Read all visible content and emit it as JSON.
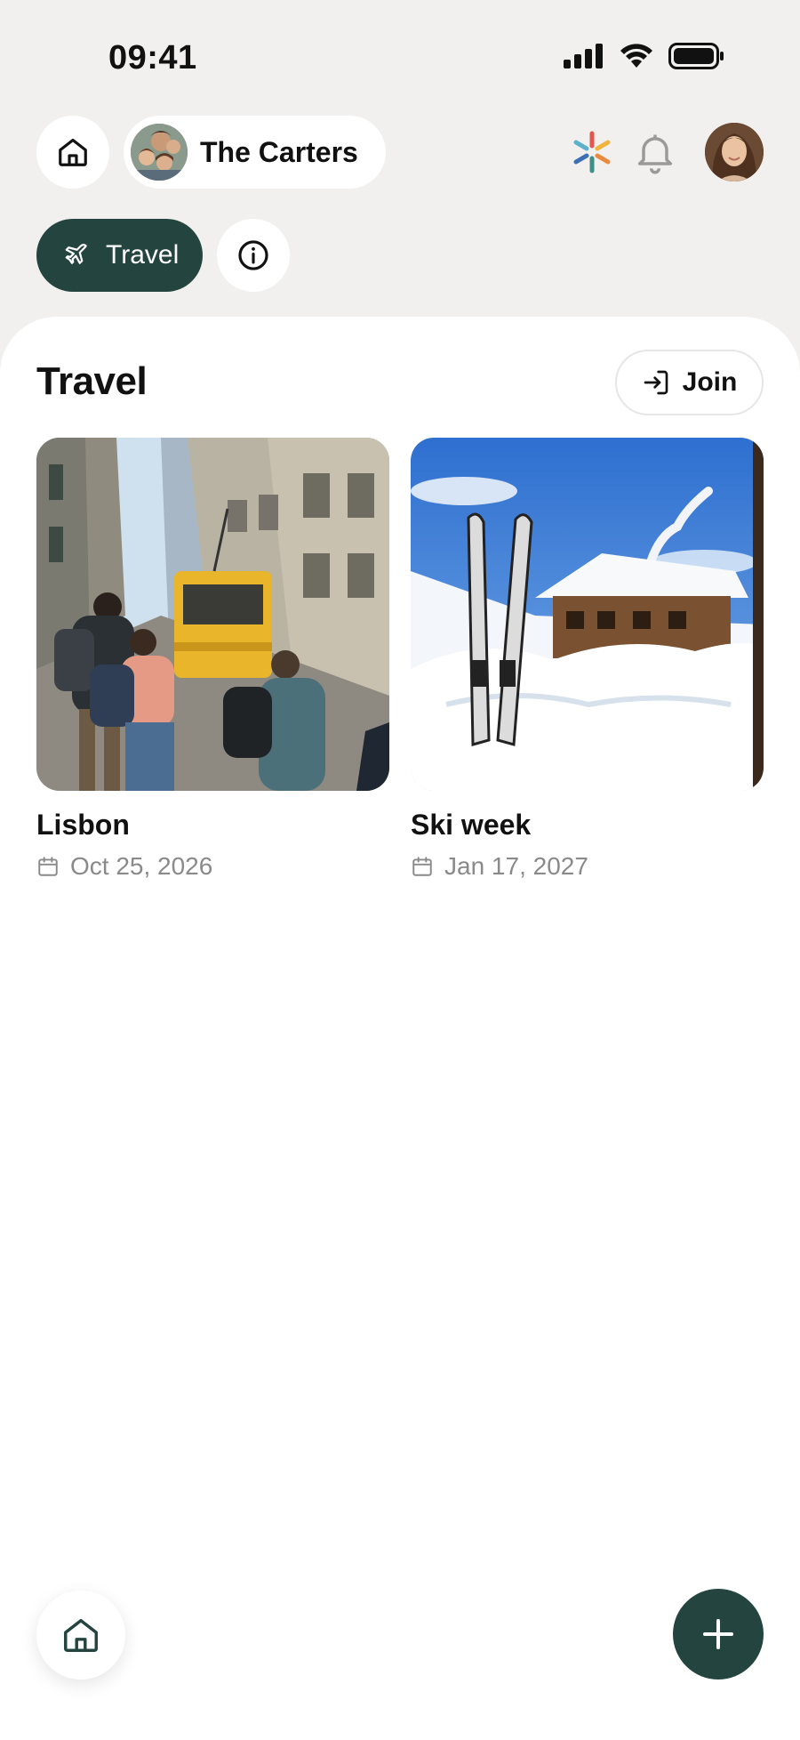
{
  "status_bar": {
    "time": "09:41"
  },
  "header": {
    "family_name": "The Carters",
    "icons": [
      "home-icon",
      "sparkle-icon",
      "bell-icon",
      "user-avatar"
    ]
  },
  "chips": {
    "active_label": "Travel",
    "active_icon": "airplane-icon",
    "info_icon": "info-icon"
  },
  "section": {
    "title": "Travel",
    "join_label": "Join",
    "join_icon": "sign-in-icon"
  },
  "trips": [
    {
      "title": "Lisbon",
      "date": "Oct 25, 2026",
      "image": "Lisbon street with yellow tram and tourists"
    },
    {
      "title": "Ski week",
      "date": "Jan 17, 2027",
      "image": "Skis in snow in front of a wooden chalet"
    }
  ],
  "bottom_bar": {
    "home_icon": "home-icon",
    "add_icon": "plus-icon"
  },
  "colors": {
    "background": "#f1f0ee",
    "accent": "#24453f",
    "sheet": "#ffffff",
    "muted_text": "#8a8a8a"
  }
}
